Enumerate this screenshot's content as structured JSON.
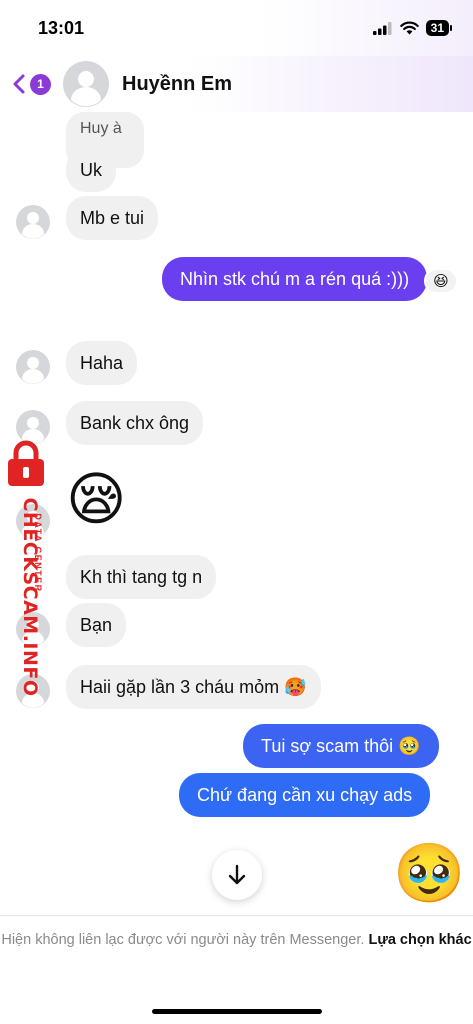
{
  "status_bar": {
    "time": "13:01",
    "battery": "31"
  },
  "header": {
    "unread_count": "1",
    "contact_name": "Huyềnn Em"
  },
  "messages": {
    "quote": "Huy à",
    "m1": "Uk",
    "m2": "Mb e tui",
    "m3": "Nhìn stk chú m a rén quá :)))",
    "m3_reaction": "😆",
    "m4": "Haha",
    "m5": "Bank chx ông",
    "m6": "😪",
    "m7": "Kh thì tang tg n",
    "m8": "Bạn",
    "m9": "Haii gặp lần 3 cháu mỏm 🥵",
    "m10": "Tui sợ scam thôi 🥹",
    "m11": "Chứ đang cần xu chạy ads",
    "m12": "🥹"
  },
  "watermark": {
    "main": "CHECKSCAM.INFO",
    "sub": "DATA CENTER"
  },
  "footer": {
    "notice": "Hiện không liên lạc được với người này trên Messenger.",
    "link": "Lựa chọn khác"
  },
  "colors": {
    "outgoing_top": "#6a3ff0",
    "outgoing_bottom": "#2f6cf5",
    "accent": "#8b3ad8",
    "watermark": "#e02424"
  }
}
